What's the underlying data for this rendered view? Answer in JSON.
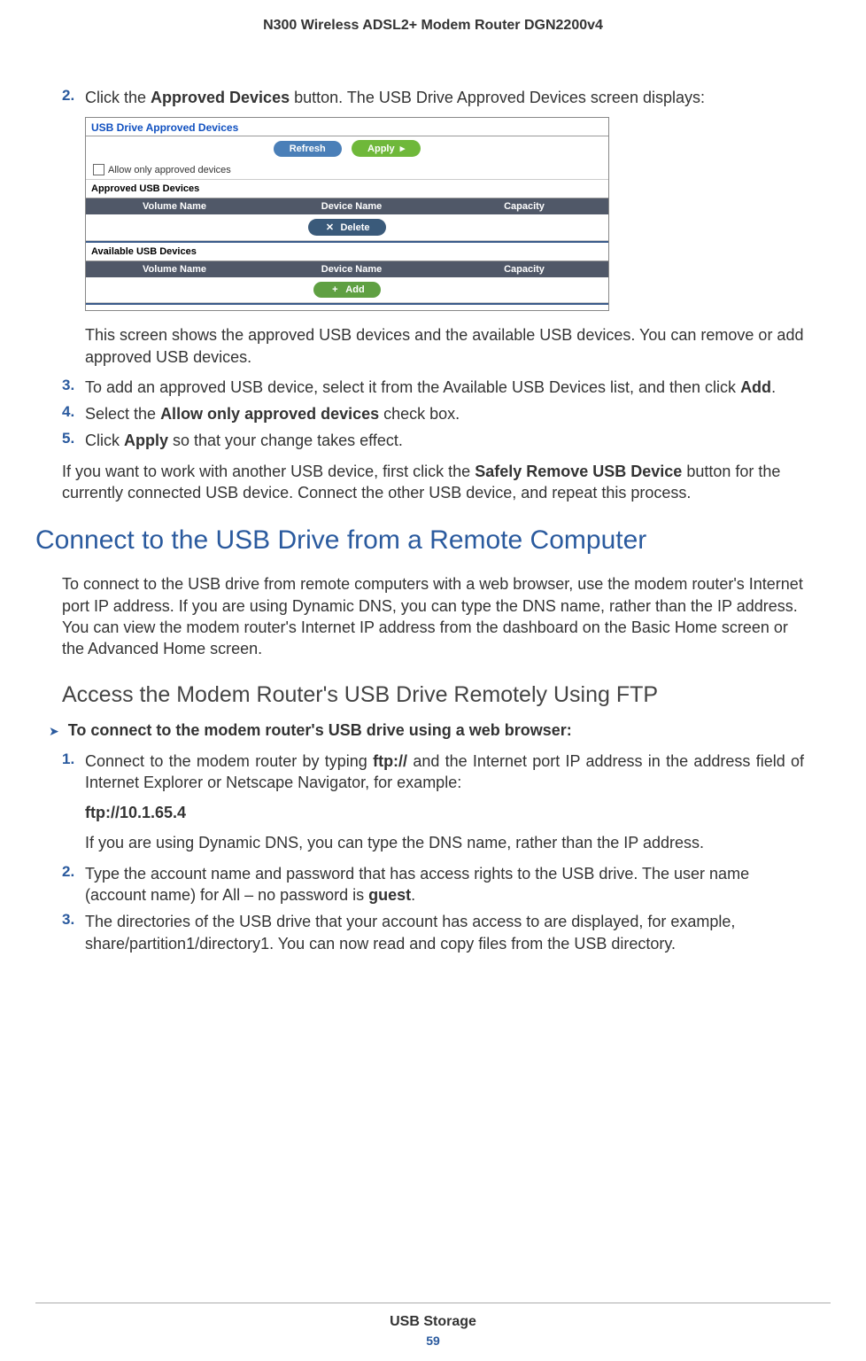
{
  "header": "N300 Wireless ADSL2+ Modem Router DGN2200v4",
  "step2": {
    "num": "2.",
    "text_before": "Click the ",
    "bold": "Approved Devices",
    "text_after": " button. The USB Drive Approved Devices screen displays:"
  },
  "screenshot": {
    "title": "USB Drive Approved Devices",
    "refresh": "Refresh",
    "apply": "Apply",
    "allow_only": "Allow only approved devices",
    "approved_label": "Approved USB Devices",
    "available_label": "Available USB Devices",
    "col_volume": "Volume Name",
    "col_device": "Device Name",
    "col_capacity": "Capacity",
    "delete": "Delete",
    "add": "Add"
  },
  "step2_after": "This screen shows the approved USB devices and the available USB devices. You can remove or add approved USB devices.",
  "step3": {
    "num": "3.",
    "text_before": "To add an approved USB device, select it from the Available USB Devices list, and then click ",
    "bold": "Add",
    "text_after": "."
  },
  "step4": {
    "num": "4.",
    "text_before": "Select the ",
    "bold": "Allow only approved devices",
    "text_after": " check box."
  },
  "step5": {
    "num": "5.",
    "text_before": "Click ",
    "bold": "Apply",
    "text_after": " so that your change takes effect."
  },
  "para_safely": {
    "before": "If you want to work with another USB device, first click the ",
    "bold": "Safely Remove USB Device",
    "after": " button for the currently connected USB device. Connect the other USB device, and repeat this process."
  },
  "h1": "Connect to the USB Drive from a Remote Computer",
  "para_connect": "To connect to the USB drive from remote computers with a web browser, use the modem router's Internet port IP address. If you are using Dynamic DNS, you can type the DNS name, rather than the IP address. You can view the modem router's Internet IP address from the dashboard on the Basic Home screen or the Advanced Home screen.",
  "h2": "Access the Modem Router's USB Drive Remotely Using FTP",
  "task": "To connect to the modem router's USB drive using a web browser:",
  "ftp_step1": {
    "num": "1.",
    "before": "Connect to the modem router by typing ",
    "bold": "ftp://",
    "after": " and the Internet port IP address in the address field of Internet Explorer or Netscape Navigator, for example:"
  },
  "ftp_example": "ftp://10.1.65.4",
  "ftp_dns": "If you are using Dynamic DNS, you can type the DNS name, rather than the IP address.",
  "ftp_step2": {
    "num": "2.",
    "before": "Type the account name and password that has access rights to the USB drive. The user name (account name) for All – no password is ",
    "bold": "guest",
    "after": "."
  },
  "ftp_step3": {
    "num": "3.",
    "text": "The directories of the USB drive that your account has access to are displayed, for example, share/partition1/directory1. You can now read and copy files from the USB directory."
  },
  "footer": {
    "title": "USB Storage",
    "page": "59"
  }
}
